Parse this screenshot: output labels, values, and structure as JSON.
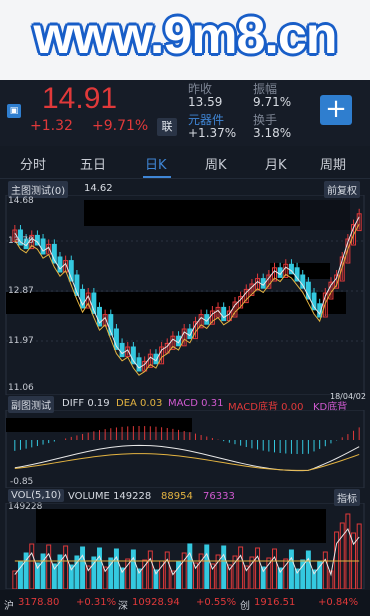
{
  "banner": {
    "text": "www.9m8.cn"
  },
  "quote": {
    "price": "14.91",
    "change": "+1.32",
    "change_pct": "+9.71%",
    "lian_label": "联",
    "stats": [
      {
        "label": "昨收",
        "value": "13.59"
      },
      {
        "label": "振幅",
        "value": "9.71%"
      },
      {
        "label": "元器件",
        "value": "+1.37%"
      },
      {
        "label": "换手",
        "value": "3.18%"
      }
    ],
    "plus_label": "+"
  },
  "tabs": [
    "分时",
    "五日",
    "日K",
    "周K",
    "月K",
    "周期"
  ],
  "active_tab": "日K",
  "main_chart": {
    "indicator_label": "主图测试(0)",
    "indicator_value": "14.62",
    "adjust_label": "前复权",
    "y_ticks": [
      "14.68",
      "13.78",
      "12.87",
      "11.97",
      "11.06"
    ]
  },
  "sub_chart": {
    "label": "副图测试",
    "diff_label": "DIFF",
    "diff_value": "0.19",
    "dea_label": "DEA",
    "dea_value": "0.03",
    "macd_label": "MACD",
    "macd_value": "0.31",
    "macd_bottom_label": "MACD底背",
    "macd_bottom_value": "0.00",
    "kd_label": "KD底背",
    "date": "18/04/02",
    "y_low": "-0.85"
  },
  "volume_chart": {
    "label": "VOL(5,10)",
    "volume_label": "VOLUME",
    "volume_value": "149228",
    "ma5_value": "88954",
    "ma10_value": "76333",
    "switch_label": "指标",
    "y_top": "149228"
  },
  "bottom_bar": {
    "sh_label": "沪",
    "sh_value": "3178.80",
    "sh_pct": "+0.31%",
    "sz_label": "深",
    "sz_value": "10928.94",
    "sz_pct": "+0.55%",
    "cy_label": "创",
    "cy_value": "1916.51",
    "cy_pct": "+0.84%"
  },
  "colors": {
    "up": "#e0393a",
    "down": "#34c9e0",
    "accent": "#3f86d6",
    "bg": "#141a24"
  }
}
